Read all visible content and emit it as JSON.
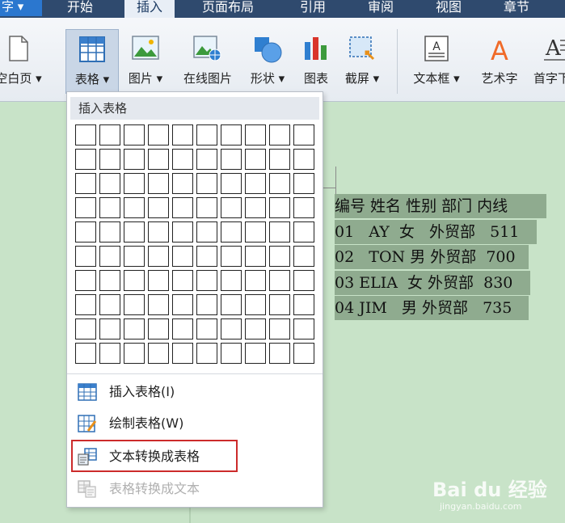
{
  "menubar": {
    "app_button": "字 ▾",
    "tabs": [
      {
        "label": "开始"
      },
      {
        "label": "插入",
        "active": true
      },
      {
        "label": "页面布局"
      },
      {
        "label": "引用"
      },
      {
        "label": "审阅"
      },
      {
        "label": "视图"
      },
      {
        "label": "章节"
      }
    ]
  },
  "ribbon": {
    "items": [
      {
        "label": "空白页 ▾",
        "icon": "blank-page-icon"
      },
      {
        "label": "表格 ▾",
        "icon": "table-icon",
        "pressed": true
      },
      {
        "label": "图片 ▾",
        "icon": "picture-icon"
      },
      {
        "label": "在线图片",
        "icon": "online-picture-icon"
      },
      {
        "label": "形状 ▾",
        "icon": "shapes-icon"
      },
      {
        "label": "图表",
        "icon": "chart-icon"
      },
      {
        "label": "截屏 ▾",
        "icon": "screenshot-icon"
      },
      {
        "label": "文本框 ▾",
        "icon": "textbox-icon"
      },
      {
        "label": "艺术字",
        "icon": "wordart-icon"
      },
      {
        "label": "首字下",
        "icon": "dropcap-icon"
      }
    ]
  },
  "dropdown": {
    "header": "插入表格",
    "grid": {
      "rows": 10,
      "cols": 10
    },
    "items": [
      {
        "label": "插入表格(I)",
        "icon": "insert-table-icon",
        "enabled": true
      },
      {
        "label": "绘制表格(W)",
        "icon": "draw-table-icon",
        "enabled": true
      },
      {
        "label": "文本转换成表格",
        "icon": "text-to-table-icon",
        "enabled": true,
        "highlighted": true
      },
      {
        "label": "表格转换成文本",
        "icon": "table-to-text-icon",
        "enabled": false
      }
    ]
  },
  "document": {
    "lines": [
      "编号 姓名 性别 部门 内线",
      "01   AY  女   外贸部   511",
      "02   TON 男 外贸部  700",
      "03 ELIA  女 外贸部  830",
      "04 JIM   男 外贸部   735"
    ]
  },
  "watermark": {
    "logo": "Bai du 经验",
    "url": "jingyan.baidu.com"
  },
  "colors": {
    "menubar": "#2f4a6e",
    "selection": "#8fab8f",
    "document_bg": "#c8e3c8",
    "highlight": "#cc2b2b"
  }
}
